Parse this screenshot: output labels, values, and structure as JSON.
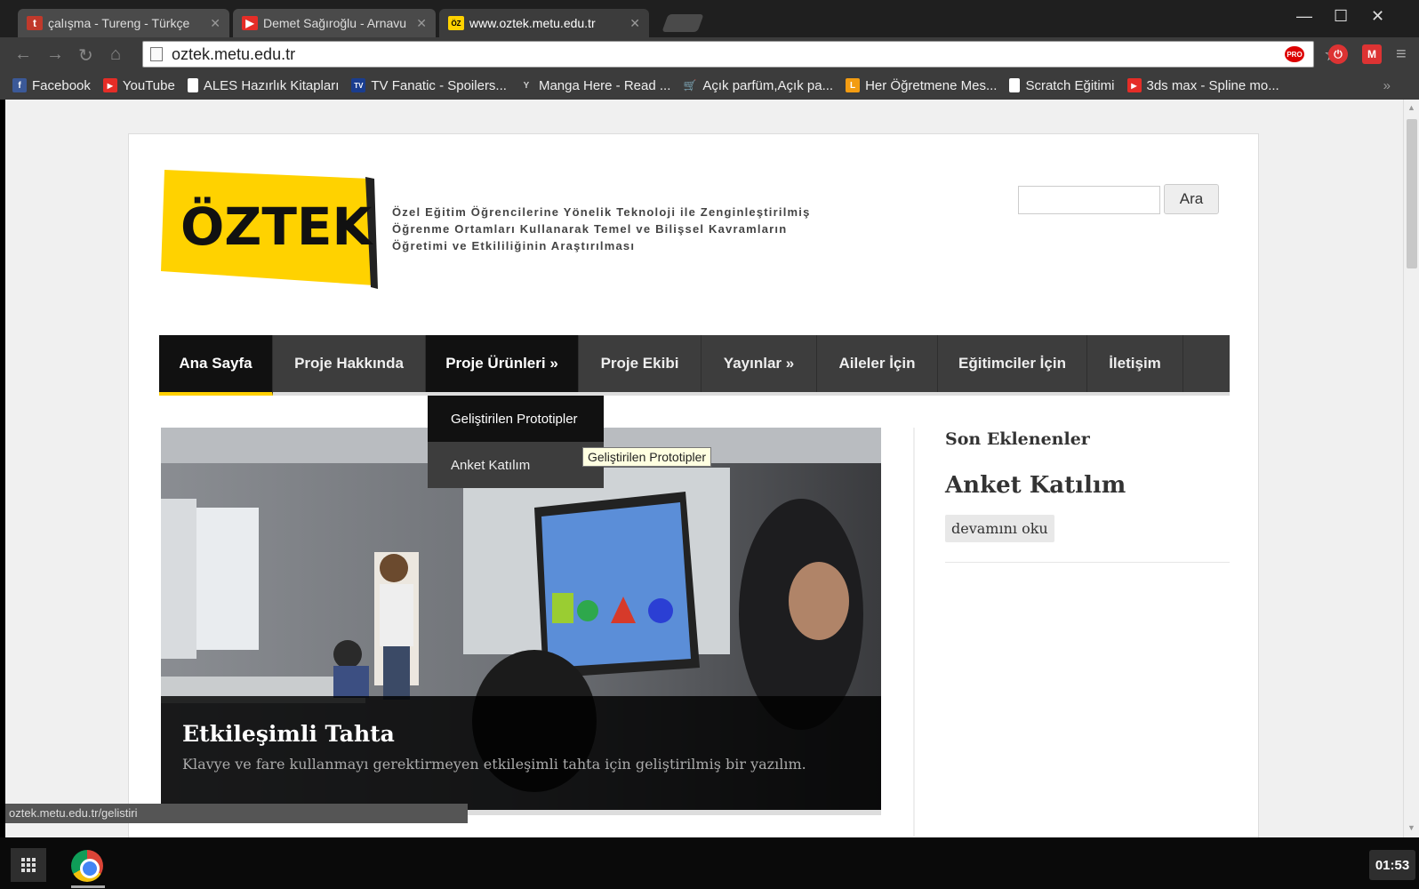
{
  "browser": {
    "tabs": [
      {
        "title": "çalışma - Tureng - Türkçe",
        "favicon": "t",
        "favicon_color": "#c0392b"
      },
      {
        "title": "Demet Sağıroğlu - Arnavu",
        "favicon": "▶",
        "favicon_color": "#e52d27"
      },
      {
        "title": "www.oztek.metu.edu.tr",
        "favicon": "ÖZ",
        "favicon_color": "#ffd200"
      }
    ],
    "address": "oztek.metu.edu.tr",
    "pro_badge": "PRO",
    "bookmarks": [
      {
        "label": "Facebook",
        "icon": "f",
        "color": "#3b5998"
      },
      {
        "label": "YouTube",
        "icon": "▶",
        "color": "#e52d27"
      },
      {
        "label": "ALES Hazırlık Kitapları",
        "icon": "",
        "color": "#ffffff"
      },
      {
        "label": "TV Fanatic - Spoilers...",
        "icon": "TV",
        "color": "#1a3d8f"
      },
      {
        "label": "Manga Here - Read ...",
        "icon": "Y",
        "color": "#3c3c3c"
      },
      {
        "label": "Açık parfüm,Açık pa...",
        "icon": "🛒",
        "color": "#3c3c3c"
      },
      {
        "label": "Her Öğretmene Mes...",
        "icon": "L",
        "color": "#f39c12"
      },
      {
        "label": "Scratch Eğitimi",
        "icon": "",
        "color": "#ffffff"
      },
      {
        "label": "3ds max - Spline mo...",
        "icon": "▶",
        "color": "#e52d27"
      }
    ],
    "bookmarks_more": "»"
  },
  "site": {
    "logo_text": "ÖZTEK",
    "tagline": [
      "Özel Eğitim Öğrencilerine Yönelik Teknoloji ile Zenginleştirilmiş",
      "Öğrenme Ortamları Kullanarak Temel ve Bilişsel Kavramların",
      "Öğretimi ve Etkililiğinin Araştırılması"
    ],
    "search_button": "Ara",
    "nav": [
      "Ana Sayfa",
      "Proje Hakkında",
      "Proje Ürünleri »",
      "Proje Ekibi",
      "Yayınlar »",
      "Aileler İçin",
      "Eğitimciler İçin",
      "İletişim"
    ],
    "submenu": [
      "Geliştirilen Prototipler",
      "Anket Katılım"
    ],
    "tooltip": "Geliştirilen Prototipler",
    "slide": {
      "title": "Etkileşimli Tahta",
      "description": "Klavye ve fare kullanmayı gerektirmeyen etkileşimli tahta için geliştirilmiş bir yazılım."
    },
    "sidebar": {
      "heading": "Son Eklenenler",
      "post_title": "Anket Katılım",
      "read_more": "devamını oku"
    }
  },
  "status_url": "oztek.metu.edu.tr/gelistiri",
  "taskbar": {
    "clock": "01:53"
  },
  "colors": {
    "logo_yellow": "#ffd200",
    "nav_bg": "#3d3d3d",
    "nav_active": "#111111",
    "accent": "#ffd000"
  }
}
